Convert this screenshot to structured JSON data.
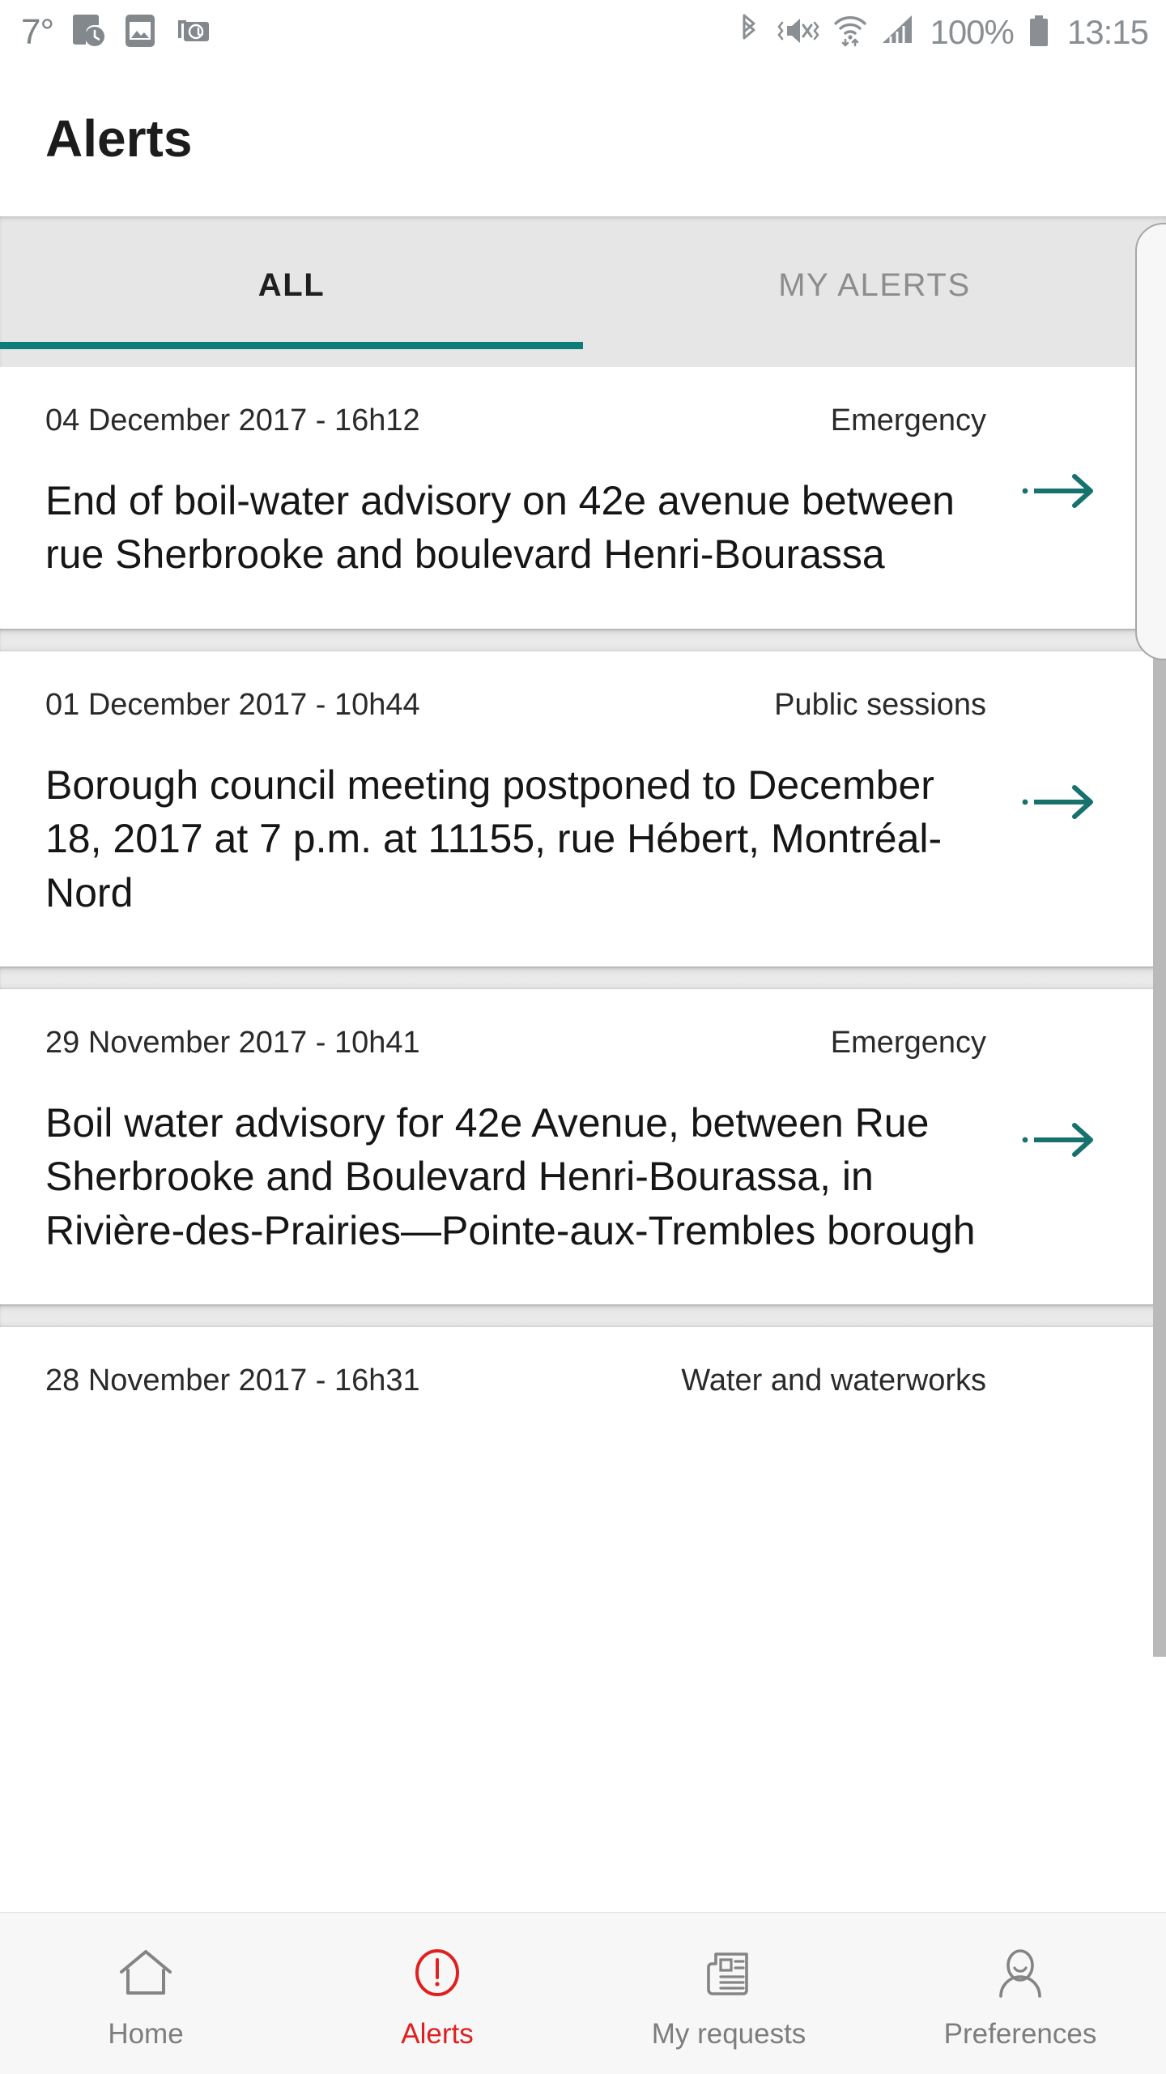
{
  "status_bar": {
    "temperature": "7°",
    "battery_percent": "100%",
    "clock": "13:15",
    "left_icons": [
      "phone-clock-icon",
      "image-icon",
      "email-stack-icon"
    ],
    "right_icons": [
      "bluetooth-icon",
      "mute-vibrate-icon",
      "wifi-icon",
      "cellular-signal-icon",
      "battery-icon"
    ]
  },
  "header": {
    "title": "Alerts"
  },
  "tabs": [
    {
      "label": "ALL",
      "active": true
    },
    {
      "label": "MY ALERTS",
      "active": false
    }
  ],
  "alerts": [
    {
      "date": "04 December 2017 - 16h12",
      "category": "Emergency",
      "title": "End of boil-water advisory on 42e avenue between rue Sherbrooke and boulevard Henri-Bourassa"
    },
    {
      "date": "01 December 2017 - 10h44",
      "category": "Public sessions",
      "title": "Borough council meeting postponed to December 18, 2017 at 7 p.m. at 11155, rue Hébert, Montréal-Nord"
    },
    {
      "date": "29 November 2017 - 10h41",
      "category": "Emergency",
      "title": "Boil water advisory for 42e Avenue, between Rue Sherbrooke and Boulevard Henri-Bourassa, in Rivière-des-Prairies—Pointe-aux-Trembles borough"
    },
    {
      "date": "28 November 2017 - 16h31",
      "category": "Water and waterworks",
      "title": ""
    }
  ],
  "bottom_nav": [
    {
      "label": "Home",
      "icon": "home-icon",
      "active": false
    },
    {
      "label": "Alerts",
      "icon": "alert-circle-icon",
      "active": true
    },
    {
      "label": "My requests",
      "icon": "document-list-icon",
      "active": false
    },
    {
      "label": "Preferences",
      "icon": "person-icon",
      "active": false
    }
  ],
  "colors": {
    "accent_teal": "#0e7d7a",
    "active_nav_red": "#e02020",
    "tabbar_bg": "#e6e6e6",
    "bottomnav_bg": "#f7f7f7",
    "status_gray": "#8a8f93"
  }
}
